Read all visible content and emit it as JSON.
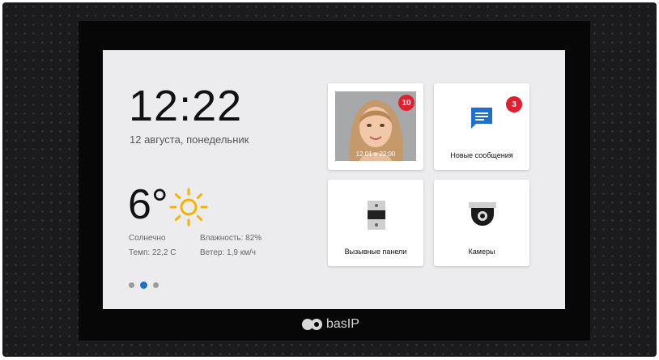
{
  "home": {
    "time": "12:22",
    "date": "12 августа, понедельник"
  },
  "weather": {
    "temperature": "6°",
    "condition": "Солнечно",
    "temp_detail": "Темп: 22,2 С",
    "humidity": "Влажность: 82%",
    "wind": "Ветер: 1,9 км/ч",
    "icon": "sun-icon"
  },
  "pager": {
    "count": 3,
    "active_index": 1
  },
  "tiles": {
    "visitors": {
      "badge": "10",
      "timestamp": "12.01 в 22:00"
    },
    "messages": {
      "label": "Новые сообщения",
      "badge": "3",
      "icon": "message-icon"
    },
    "panels": {
      "label": "Вызывные панели",
      "icon": "intercom-panel-icon"
    },
    "cameras": {
      "label": "Камеры",
      "icon": "dome-camera-icon"
    }
  },
  "device": {
    "brand": "basIP"
  },
  "colors": {
    "accent_blue": "#1f6fd0",
    "badge_red": "#e02030",
    "sun_yellow": "#f5b400",
    "screen_bg": "#ececee"
  }
}
